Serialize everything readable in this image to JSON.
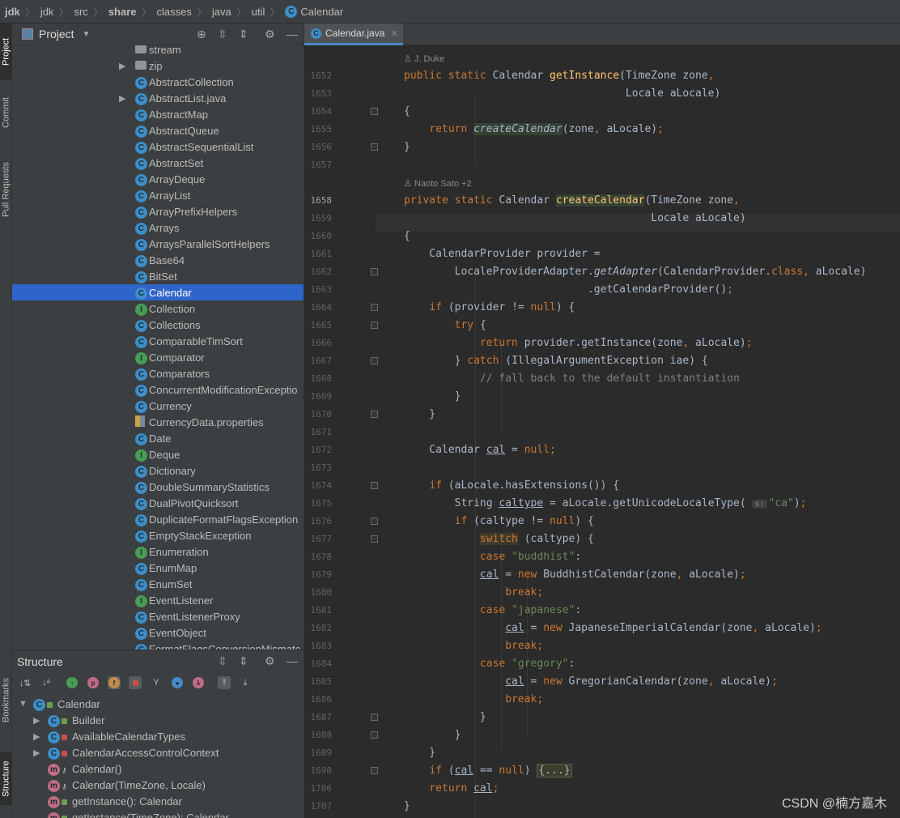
{
  "breadcrumb": {
    "items": [
      "jdk",
      "jdk",
      "src",
      "share",
      "classes",
      "java",
      "util",
      "Calendar"
    ]
  },
  "toolstrip": {
    "tabs": [
      "Project",
      "Commit",
      "Pull Requests",
      "Bookmarks",
      "Structure"
    ]
  },
  "project": {
    "title": "Project",
    "items": [
      {
        "label": "stream",
        "type": "folder",
        "arrow": false
      },
      {
        "label": "zip",
        "type": "folder",
        "arrow": true
      },
      {
        "label": "AbstractCollection",
        "type": "c",
        "color": "blue"
      },
      {
        "label": "AbstractList.java",
        "type": "c",
        "color": "blue",
        "arrow": true
      },
      {
        "label": "AbstractMap",
        "type": "c",
        "color": "blue"
      },
      {
        "label": "AbstractQueue",
        "type": "c",
        "color": "blue"
      },
      {
        "label": "AbstractSequentialList",
        "type": "c",
        "color": "blue"
      },
      {
        "label": "AbstractSet",
        "type": "c",
        "color": "blue"
      },
      {
        "label": "ArrayDeque",
        "type": "c",
        "color": "blue"
      },
      {
        "label": "ArrayList",
        "type": "c",
        "color": "blue"
      },
      {
        "label": "ArrayPrefixHelpers",
        "type": "c",
        "color": "blue"
      },
      {
        "label": "Arrays",
        "type": "c",
        "color": "blue"
      },
      {
        "label": "ArraysParallelSortHelpers",
        "type": "c",
        "color": "blue"
      },
      {
        "label": "Base64",
        "type": "c",
        "color": "blue"
      },
      {
        "label": "BitSet",
        "type": "c",
        "color": "blue"
      },
      {
        "label": "Calendar",
        "type": "c",
        "color": "blue",
        "selected": true
      },
      {
        "label": "Collection",
        "type": "I",
        "color": "green"
      },
      {
        "label": "Collections",
        "type": "c",
        "color": "blue"
      },
      {
        "label": "ComparableTimSort",
        "type": "c",
        "color": "blue"
      },
      {
        "label": "Comparator",
        "type": "I",
        "color": "green"
      },
      {
        "label": "Comparators",
        "type": "c",
        "color": "blue"
      },
      {
        "label": "ConcurrentModificationExceptio",
        "type": "c",
        "color": "blue"
      },
      {
        "label": "Currency",
        "type": "c",
        "color": "blue"
      },
      {
        "label": "CurrencyData.properties",
        "type": "prop"
      },
      {
        "label": "Date",
        "type": "c",
        "color": "blue"
      },
      {
        "label": "Deque",
        "type": "I",
        "color": "green"
      },
      {
        "label": "Dictionary",
        "type": "c",
        "color": "blue"
      },
      {
        "label": "DoubleSummaryStatistics",
        "type": "c",
        "color": "blue"
      },
      {
        "label": "DualPivotQuicksort",
        "type": "c",
        "color": "blue"
      },
      {
        "label": "DuplicateFormatFlagsException",
        "type": "c",
        "color": "blue"
      },
      {
        "label": "EmptyStackException",
        "type": "c",
        "color": "blue"
      },
      {
        "label": "Enumeration",
        "type": "I",
        "color": "green"
      },
      {
        "label": "EnumMap",
        "type": "c",
        "color": "blue"
      },
      {
        "label": "EnumSet",
        "type": "c",
        "color": "blue"
      },
      {
        "label": "EventListener",
        "type": "I",
        "color": "green"
      },
      {
        "label": "EventListenerProxy",
        "type": "c",
        "color": "blue"
      },
      {
        "label": "EventObject",
        "type": "c",
        "color": "blue"
      },
      {
        "label": "FormatFlagsConversionMismatc",
        "type": "c",
        "color": "blue"
      }
    ]
  },
  "structure": {
    "title": "Structure",
    "items": [
      {
        "label": "Calendar",
        "level": 0,
        "icon": "c",
        "color": "blue",
        "arrow": "down",
        "vis": "unlock"
      },
      {
        "label": "Builder",
        "level": 1,
        "icon": "c",
        "color": "blue",
        "arrow": "right",
        "vis": "unlock"
      },
      {
        "label": "AvailableCalendarTypes",
        "level": 1,
        "icon": "c",
        "color": "blue",
        "arrow": "right",
        "vis": "lock"
      },
      {
        "label": "CalendarAccessControlContext",
        "level": 1,
        "icon": "c",
        "color": "blue",
        "arrow": "right",
        "vis": "lock"
      },
      {
        "label": "Calendar()",
        "level": 1,
        "icon": "m",
        "color": "pink",
        "vis": "key"
      },
      {
        "label": "Calendar(TimeZone, Locale)",
        "level": 1,
        "icon": "m",
        "color": "pink",
        "vis": "key"
      },
      {
        "label": "getInstance(): Calendar",
        "level": 1,
        "icon": "m",
        "color": "pink",
        "vis": "unlock"
      },
      {
        "label": "getInstance(TimeZone): Calendar",
        "level": 1,
        "icon": "m",
        "color": "pink",
        "vis": "unlock"
      }
    ]
  },
  "editor": {
    "tab": "Calendar.java",
    "authors": [
      "J. Duke",
      "Naoto Sato +2"
    ],
    "line_numbers": [
      "1652",
      "1653",
      "1654",
      "1655",
      "1656",
      "1657",
      "1658",
      "1659",
      "1660",
      "1661",
      "1662",
      "1663",
      "1664",
      "1665",
      "1666",
      "1667",
      "1668",
      "1669",
      "1670",
      "1671",
      "1672",
      "1673",
      "1674",
      "1675",
      "1676",
      "1677",
      "1678",
      "1679",
      "1680",
      "1681",
      "1682",
      "1683",
      "1684",
      "1685",
      "1686",
      "1687",
      "1688",
      "1689",
      "1690",
      "1706",
      "1707"
    ]
  },
  "watermark": "CSDN @楠方嘉木"
}
